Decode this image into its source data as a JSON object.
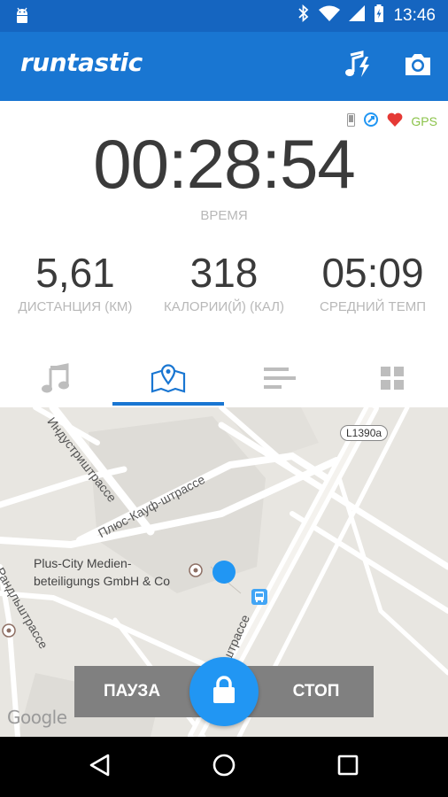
{
  "status_bar": {
    "time": "13:46"
  },
  "app": {
    "logo": "runtastic"
  },
  "sensors": {
    "gps_label": "GPS",
    "heart_color": "#e53935",
    "gps_color": "#8bc34a"
  },
  "stats": {
    "duration": {
      "value": "00:28:54",
      "label": "ВРЕМЯ"
    },
    "distance": {
      "value": "5,61",
      "label": "ДИСТАНЦИЯ (КМ)"
    },
    "calories": {
      "value": "318",
      "label": "КАЛОРИИ(Й) (КАЛ)"
    },
    "pace": {
      "value": "05:09",
      "label": "СРЕДНИЙ ТЕМП"
    }
  },
  "tabs": [
    {
      "icon": "music-note-icon"
    },
    {
      "icon": "map-pin-icon",
      "active": true
    },
    {
      "icon": "bars-icon"
    },
    {
      "icon": "grid-icon"
    }
  ],
  "map": {
    "streets": {
      "industrie": "Индустриштрассе",
      "plus_kauf": "Плюс-Кауф-штрассе",
      "randl": "Рандльштрассе",
      "bottom": "штрассе"
    },
    "road_tag": "L1390a",
    "poi": {
      "line1": "Plus-City Medien-",
      "line2": "beteiligungs GmbH & Co"
    },
    "attribution": "Google"
  },
  "controls": {
    "pause": "ПАУЗА",
    "stop": "СТОП"
  },
  "colors": {
    "primary": "#1976d2",
    "status": "#1565c0",
    "accent": "#2196f3"
  }
}
